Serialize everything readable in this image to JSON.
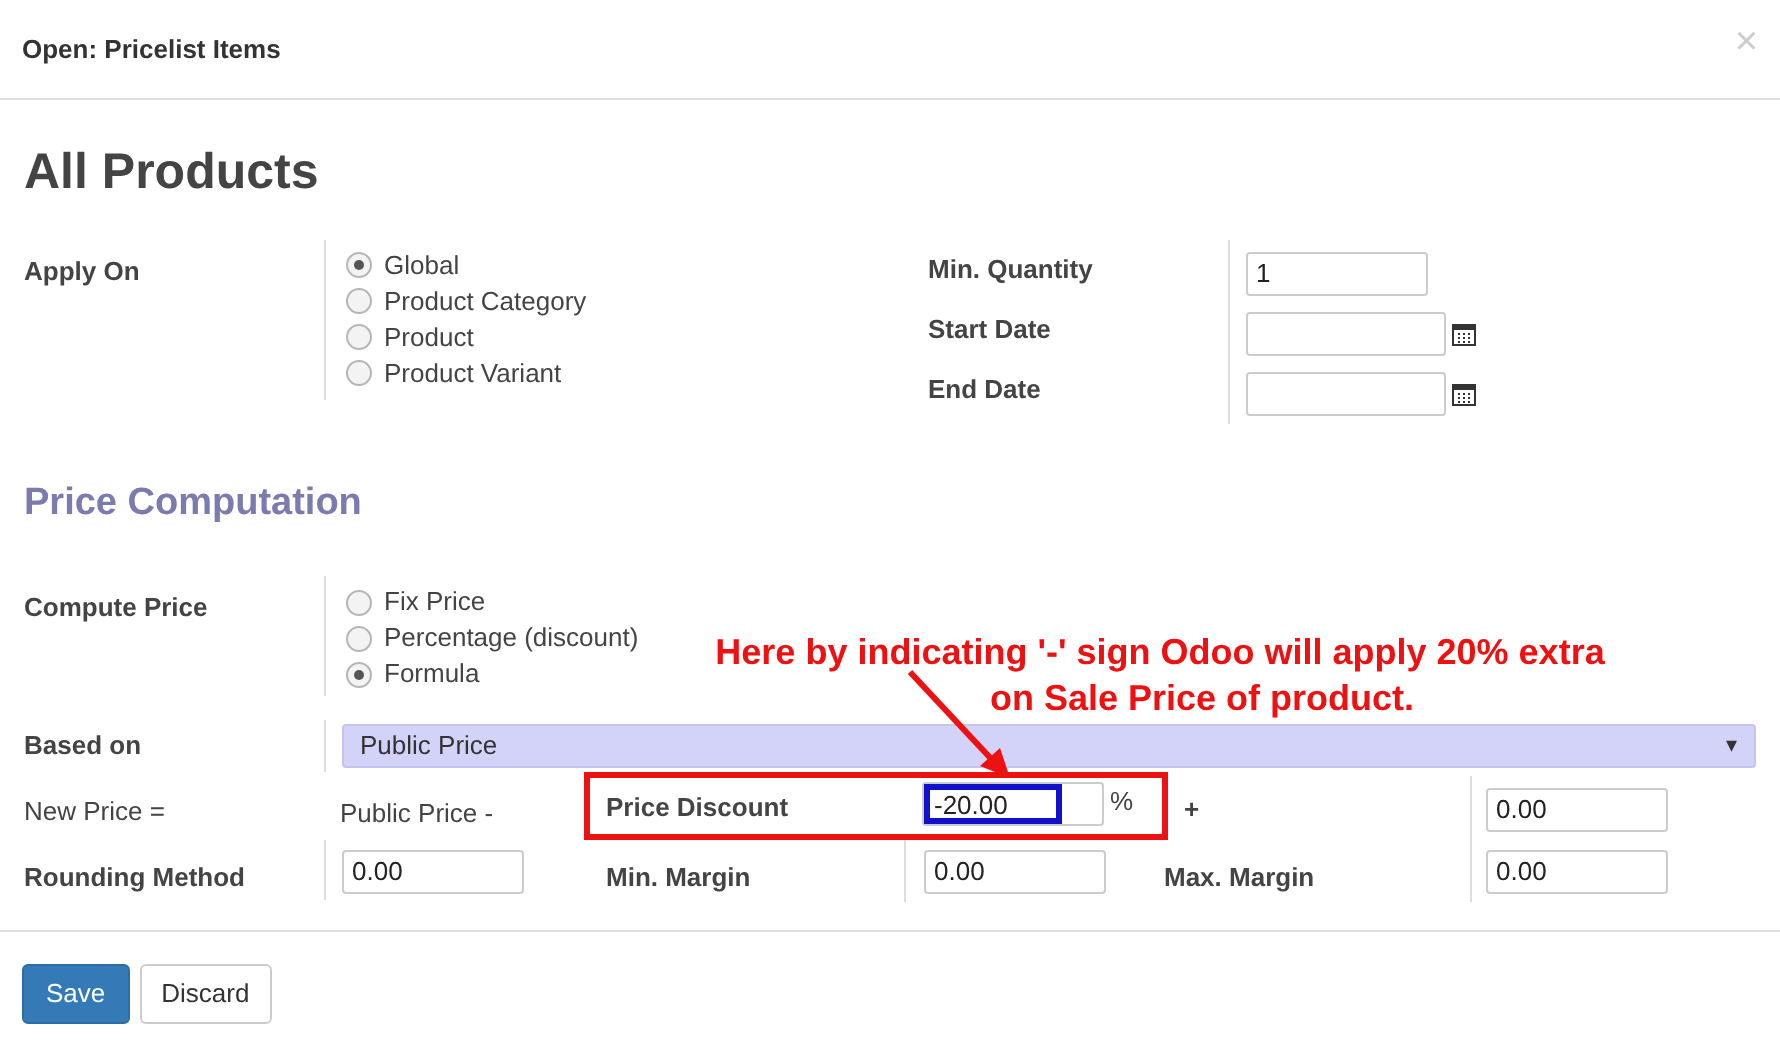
{
  "window": {
    "title": "Open: Pricelist Items",
    "close": "×"
  },
  "heading": "All Products",
  "apply_on": {
    "label": "Apply On",
    "options": [
      {
        "label": "Global",
        "selected": true
      },
      {
        "label": "Product Category",
        "selected": false
      },
      {
        "label": "Product",
        "selected": false
      },
      {
        "label": "Product Variant",
        "selected": false
      }
    ]
  },
  "side_fields": [
    {
      "label": "Min. Quantity",
      "kind": "number",
      "value": "1"
    },
    {
      "label": "Start Date",
      "kind": "date"
    },
    {
      "label": "End Date",
      "kind": "date"
    }
  ],
  "section_title": "Price Computation",
  "compute_price": {
    "label": "Compute Price",
    "options": [
      {
        "label": "Fix Price",
        "selected": false
      },
      {
        "label": "Percentage (discount)",
        "selected": false
      },
      {
        "label": "Formula",
        "selected": true
      }
    ]
  },
  "based_on": {
    "label": "Based on",
    "value": "Public Price",
    "caret": "▾"
  },
  "formula": {
    "new_price_label": "New Price =",
    "base_text": "Public Price -",
    "discount_label": "Price Discount",
    "discount_value": "-20.00",
    "percent": "%",
    "plus": "+",
    "surcharge_value": "0.00",
    "rounding_label": "Rounding Method",
    "rounding_value": "0.00",
    "min_margin_label": "Min. Margin",
    "min_margin_value": "0.00",
    "max_margin_label": "Max. Margin",
    "max_margin_value": "0.00"
  },
  "annotation": {
    "lines": [
      "Here by indicating '-' sign Odoo will apply 20% extra",
      "on Sale Price of product."
    ]
  },
  "buttons": [
    {
      "label": "Save",
      "kind": "primary"
    },
    {
      "label": "Discard",
      "kind": "secondary"
    }
  ]
}
